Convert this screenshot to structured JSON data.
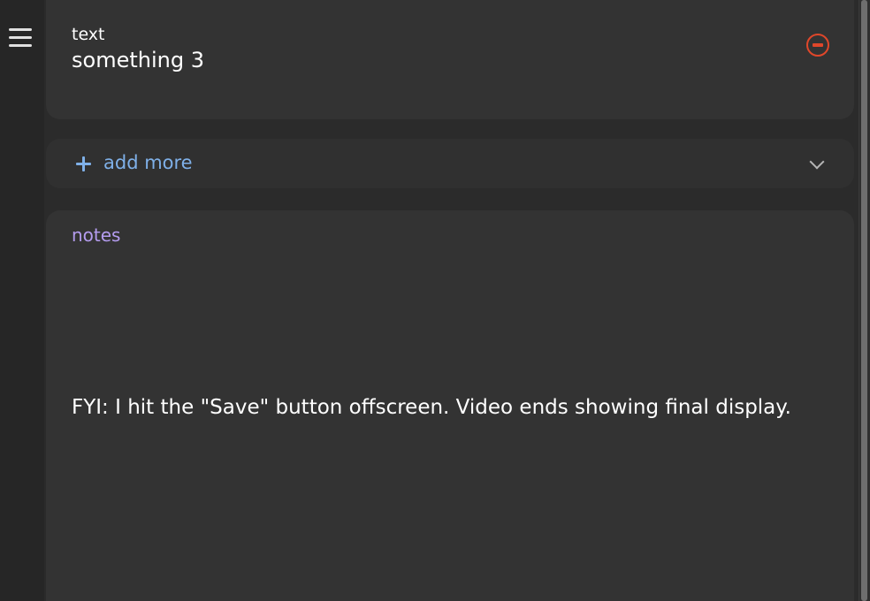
{
  "sidebar": {
    "menu_icon": "hamburger-menu-icon"
  },
  "item": {
    "label": "text",
    "value": "something 3",
    "remove_icon": "remove-circle-icon",
    "remove_color": "#e0472a"
  },
  "add_more": {
    "icon": "plus-icon",
    "label": "add more",
    "color": "#7fb0e8",
    "expand_icon": "chevron-down-icon"
  },
  "notes": {
    "label": "notes",
    "label_color": "#b49cef",
    "text": "FYI: I hit the \"Save\" button offscreen. Video ends showing final display."
  },
  "colors": {
    "background": "#2b2b2b",
    "card": "#333333"
  }
}
